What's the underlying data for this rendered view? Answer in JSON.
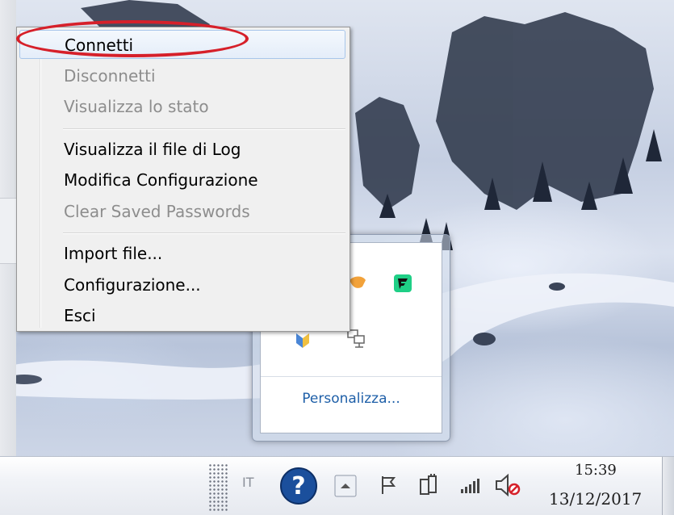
{
  "context_menu": {
    "items": [
      {
        "label": "Connetti",
        "enabled": true,
        "highlighted": true
      },
      {
        "label": "Disconnetti",
        "enabled": false
      },
      {
        "label": "Visualizza lo stato",
        "enabled": false
      },
      {
        "label": "Visualizza il file di Log",
        "enabled": true
      },
      {
        "label": "Modifica Configurazione",
        "enabled": true
      },
      {
        "label": "Clear Saved Passwords",
        "enabled": false
      },
      {
        "label": "Import file...",
        "enabled": true
      },
      {
        "label": "Configurazione...",
        "enabled": true
      },
      {
        "label": "Esci",
        "enabled": true
      }
    ],
    "annotation_color": "#d6202a"
  },
  "tray_flyout": {
    "customize_label": "Personalizza...",
    "icons": [
      "orange-app-icon",
      "green-f-app-icon",
      "blue-shield-icon",
      "network-computers-icon"
    ]
  },
  "taskbar": {
    "language": "IT",
    "icons": [
      "help-icon",
      "show-hidden-icons-chevron",
      "action-center-flag-icon",
      "power-battery-icon",
      "signal-bars-icon",
      "volume-muted-icon"
    ],
    "clock": {
      "time": "15:39",
      "date": "13/12/2017"
    }
  },
  "colors": {
    "link_blue": "#1e5fa8",
    "green_app": "#1fcf86",
    "help_blue": "#1b4f9c"
  }
}
